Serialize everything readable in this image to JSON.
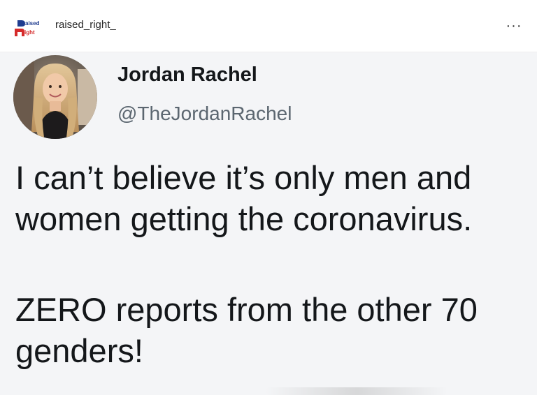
{
  "post": {
    "account_name": "raised_right_",
    "logo_text_line1": "aised",
    "logo_text_line2": "ight",
    "more_label": "···"
  },
  "tweet": {
    "display_name": "Jordan Rachel",
    "handle": "@TheJordanRachel",
    "lines": [
      "I can’t believe it’s only men and",
      "women getting the coronavirus.",
      "ZERO reports from the other 70",
      "genders!"
    ]
  },
  "colors": {
    "logo_blue": "#1f3c8f",
    "logo_red": "#d52b2b",
    "tweet_background": "#f4f5f7",
    "handle_gray": "#5b6670"
  }
}
